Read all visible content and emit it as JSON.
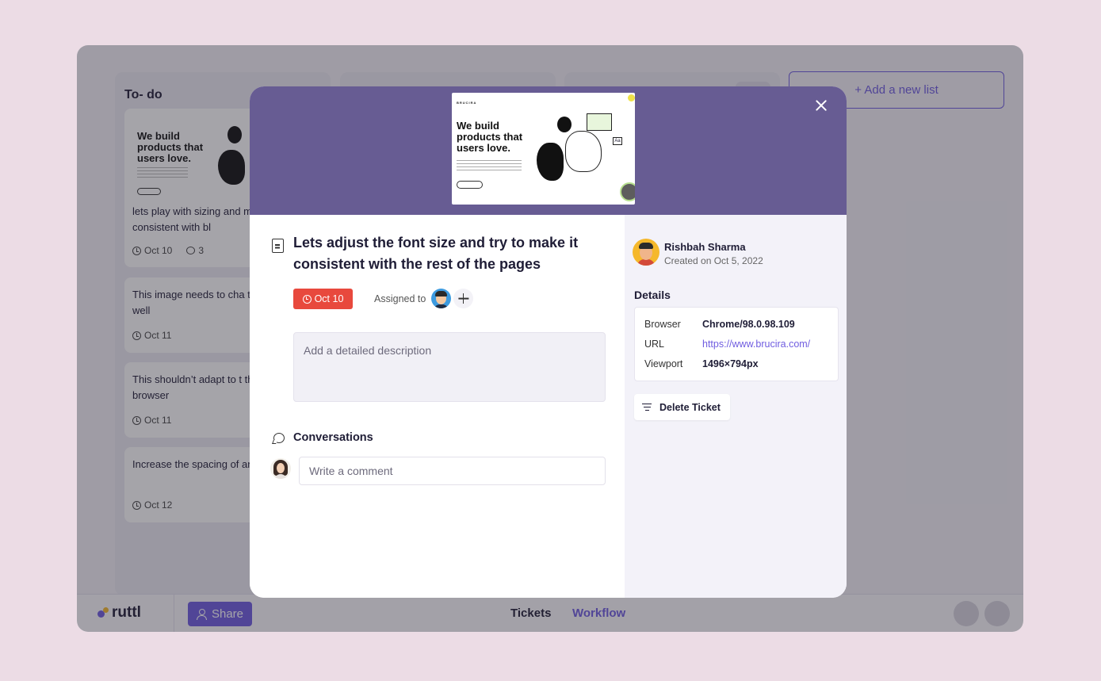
{
  "board": {
    "columns": [
      {
        "title": "To- do",
        "cards": [
          {
            "thumb_heading": "We build products that users love.",
            "title": "lets play with sizing and make consistent with bl",
            "date": "Oct 10",
            "comments": "3"
          },
          {
            "title": "This image needs to cha the style as well",
            "date": "Oct 11"
          },
          {
            "title": "This shouldn’t adapt to t theme of the browser",
            "date": "Oct 11"
          },
          {
            "title": "Increase the spacing of and the text",
            "date": "Oct 12"
          }
        ]
      }
    ],
    "add_list_label": "+ Add a new list"
  },
  "bottombar": {
    "logo_text": "ruttl",
    "share_label": "Share",
    "nav": {
      "tickets": "Tickets",
      "workflow": "Workflow"
    }
  },
  "modal": {
    "preview": {
      "brand": "BRUCIRA",
      "heading": "We build products that users love.",
      "badge_text": "Aa"
    },
    "ticket_title": "Lets adjust the font size and try to make it consistent with the rest of the pages",
    "due_date": "Oct 10",
    "assigned_label": "Assigned to",
    "description_placeholder": "Add a detailed description",
    "conversations_title": "Conversations",
    "comment_placeholder": "Write a comment",
    "author": {
      "name": "Rishbah Sharma",
      "created": "Created on Oct 5, 2022"
    },
    "details_title": "Details",
    "details": [
      {
        "key": "Browser",
        "value": "Chrome/98.0.98.109"
      },
      {
        "key": "URL",
        "value": "https://www.brucira.com/"
      },
      {
        "key": "Viewport",
        "value": "1496×794px"
      }
    ],
    "delete_label": "Delete Ticket"
  },
  "colors": {
    "accent": "#6f5ce0",
    "modal_header": "#675c93",
    "date_badge": "#e8493d",
    "background": "#ecdce5"
  },
  "icons": [
    "close-icon",
    "document-icon",
    "clock-icon",
    "plus-icon",
    "chat-bubble-icon",
    "filter-icon",
    "user-add-icon"
  ]
}
